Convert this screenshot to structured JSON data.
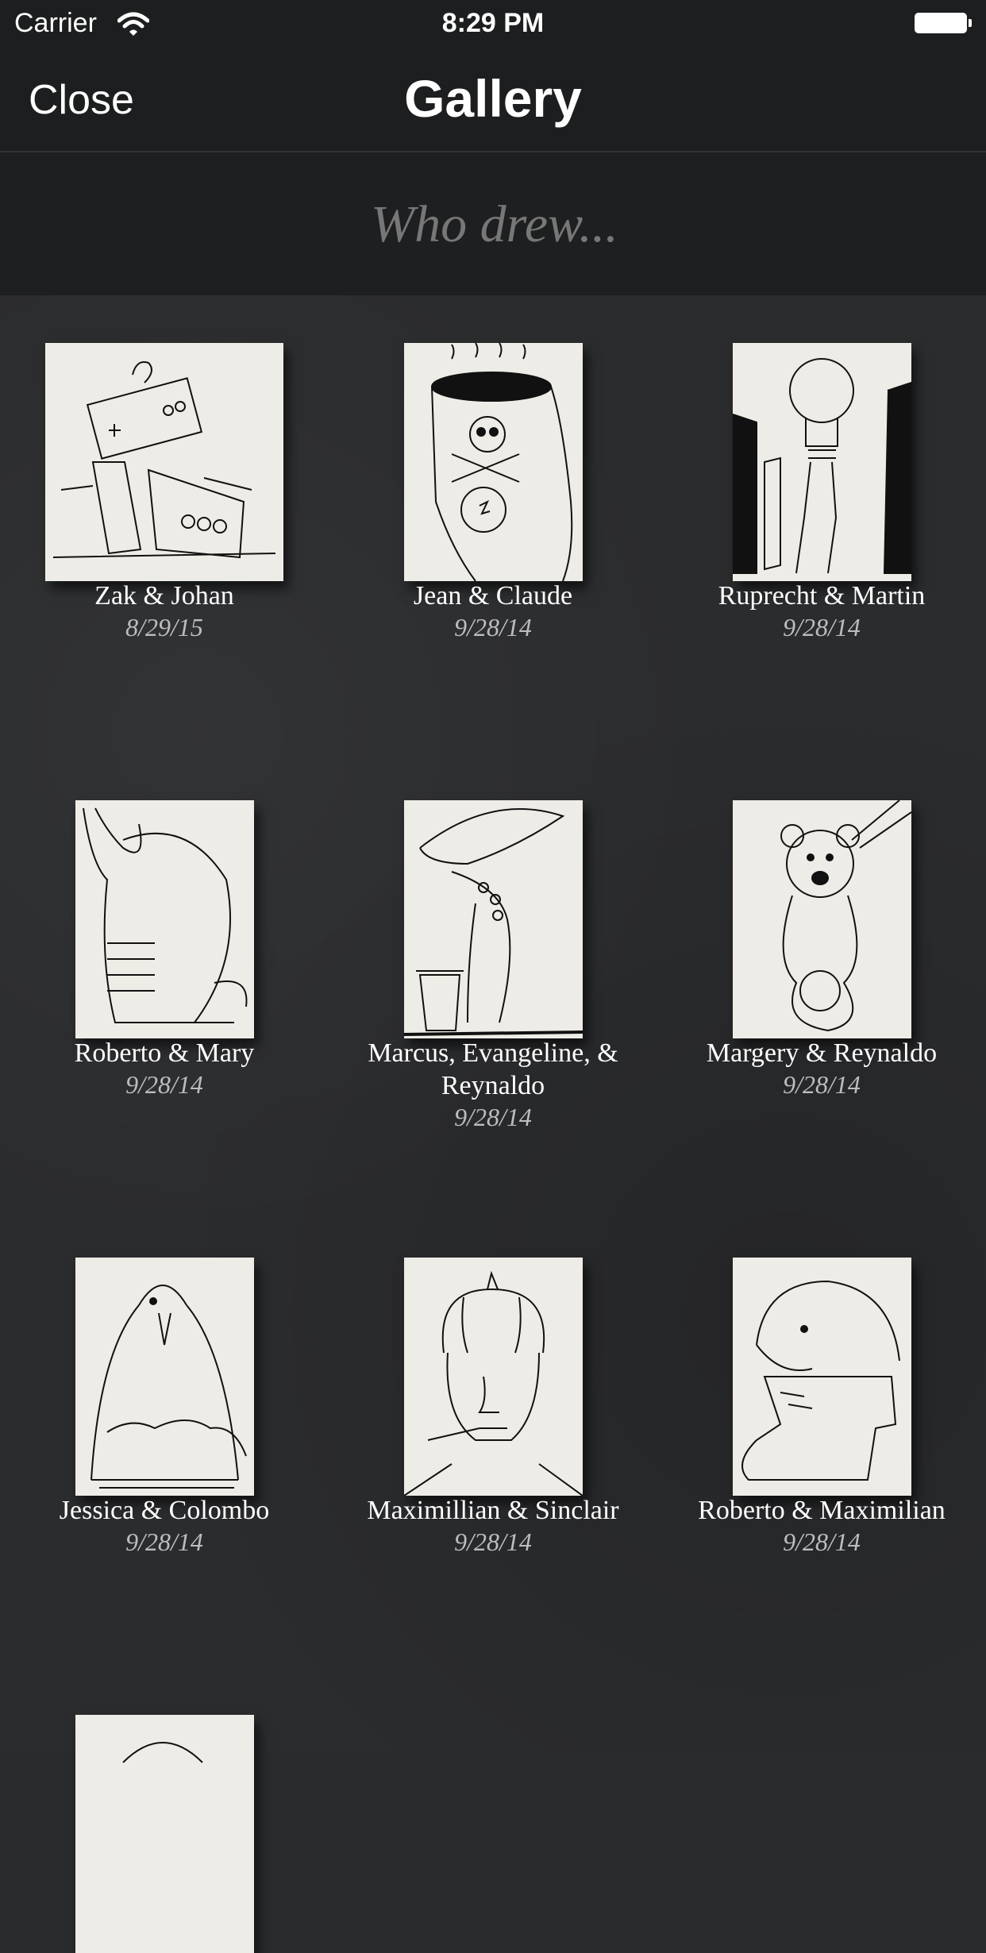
{
  "status_bar": {
    "carrier": "Carrier",
    "time": "8:29 PM"
  },
  "nav": {
    "close_label": "Close",
    "title": "Gallery"
  },
  "search": {
    "placeholder": "Who drew..."
  },
  "gallery": {
    "items": [
      {
        "names": "Zak & Johan",
        "date": "8/29/15",
        "drawing": "robot-tank-drawing"
      },
      {
        "names": "Jean & Claude",
        "date": "9/28/14",
        "drawing": "coffee-cup-monster-drawing"
      },
      {
        "names": "Ruprecht & Martin",
        "date": "9/28/14",
        "drawing": "lightbulb-figure-drawing"
      },
      {
        "names": "Roberto & Mary",
        "date": "9/28/14",
        "drawing": "elephant-drawing"
      },
      {
        "names": "Marcus, Evangeline, & Reynaldo",
        "date": "9/28/14",
        "drawing": "octopus-trashcan-drawing"
      },
      {
        "names": "Margery & Reynaldo",
        "date": "9/28/14",
        "drawing": "teddy-bear-drawing"
      },
      {
        "names": "Jessica & Colombo",
        "date": "9/28/14",
        "drawing": "penguin-drawing"
      },
      {
        "names": "Maximillian & Sinclair",
        "date": "9/28/14",
        "drawing": "pumpkin-head-drawing"
      },
      {
        "names": "Roberto & Maximilian",
        "date": "9/28/14",
        "drawing": "animal-boot-drawing"
      },
      {
        "names": "",
        "date": "",
        "drawing": "partial-drawing"
      }
    ]
  }
}
